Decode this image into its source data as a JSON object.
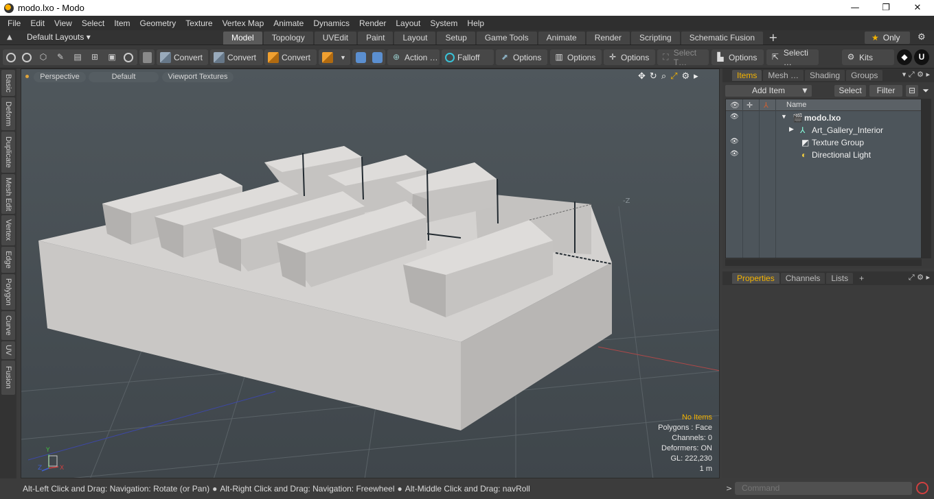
{
  "window": {
    "title": "modo.lxo - Modo",
    "minimize": "—",
    "maximize": "❐",
    "close": "✕"
  },
  "menu": [
    "File",
    "Edit",
    "View",
    "Select",
    "Item",
    "Geometry",
    "Texture",
    "Vertex Map",
    "Animate",
    "Dynamics",
    "Render",
    "Layout",
    "System",
    "Help"
  ],
  "layouts": {
    "selector": "Default Layouts ▾",
    "tabs": [
      "Model",
      "Topology",
      "UVEdit",
      "Paint",
      "Layout",
      "Setup",
      "Game Tools",
      "Animate",
      "Render",
      "Scripting",
      "Schematic Fusion"
    ],
    "active_tab": "Model",
    "add": "+",
    "only_label": "Only"
  },
  "toolbar": {
    "convert1": "Convert",
    "convert2": "Convert",
    "convert3": "Convert",
    "action": "Action  …",
    "falloff": "Falloff",
    "options1": "Options",
    "options2": "Options",
    "options3": "Options",
    "select_t": "Select T…",
    "options4": "Options",
    "selecti": "Selecti …",
    "kits": "Kits"
  },
  "left_tabs": [
    "Basic",
    "Deform",
    "Duplicate",
    "Mesh Edit",
    "Vertex",
    "Edge",
    "Polygon",
    "Curve",
    "UV",
    "Fusion"
  ],
  "viewport": {
    "view": "Perspective",
    "shading": "Default",
    "textures": "Viewport Textures",
    "axis_hint": "-Z",
    "info": {
      "no_items": "No Items",
      "polygons": "Polygons : Face",
      "channels": "Channels: 0",
      "deformers": "Deformers: ON",
      "gl": "GL: 222,230",
      "scale": "1 m"
    }
  },
  "status": {
    "hint1": "Alt-Left Click and Drag: Navigation: Rotate (or Pan)",
    "hint2": "Alt-Right Click and Drag: Navigation: Freewheel",
    "hint3": "Alt-Middle Click and Drag: navRoll"
  },
  "items_panel": {
    "tabs": [
      "Items",
      "Mesh …",
      "Shading",
      "Groups"
    ],
    "active_tab": "Items",
    "add_item": "Add Item",
    "select": "Select",
    "filter": "Filter",
    "col_name": "Name",
    "rows": [
      {
        "label": "modo.lxo",
        "bold": true
      },
      {
        "label": "Art_Gallery_Interior"
      },
      {
        "label": "Texture Group"
      },
      {
        "label": "Directional Light"
      }
    ]
  },
  "props_panel": {
    "tabs": [
      "Properties",
      "Channels",
      "Lists"
    ],
    "active_tab": "Properties",
    "add": "+"
  },
  "command": {
    "prompt": ">",
    "placeholder": "Command"
  }
}
